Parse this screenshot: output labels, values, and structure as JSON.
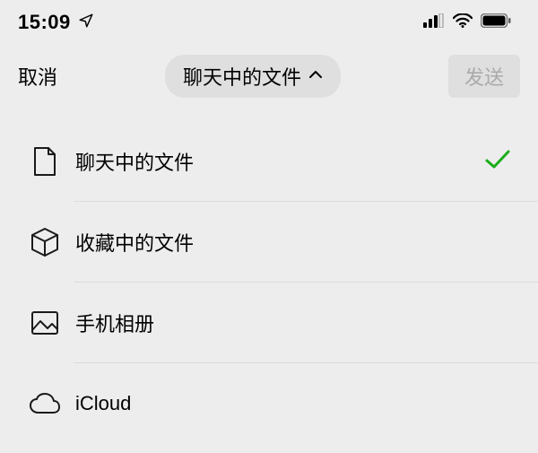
{
  "statusBar": {
    "time": "15:09"
  },
  "nav": {
    "cancel": "取消",
    "title": "聊天中的文件",
    "send": "发送"
  },
  "options": [
    {
      "icon": "file-icon",
      "label": "聊天中的文件",
      "selected": true
    },
    {
      "icon": "cube-icon",
      "label": "收藏中的文件",
      "selected": false
    },
    {
      "icon": "image-icon",
      "label": "手机相册",
      "selected": false
    },
    {
      "icon": "cloud-icon",
      "label": "iCloud",
      "selected": false
    }
  ],
  "colors": {
    "accent": "#1AAD19"
  }
}
